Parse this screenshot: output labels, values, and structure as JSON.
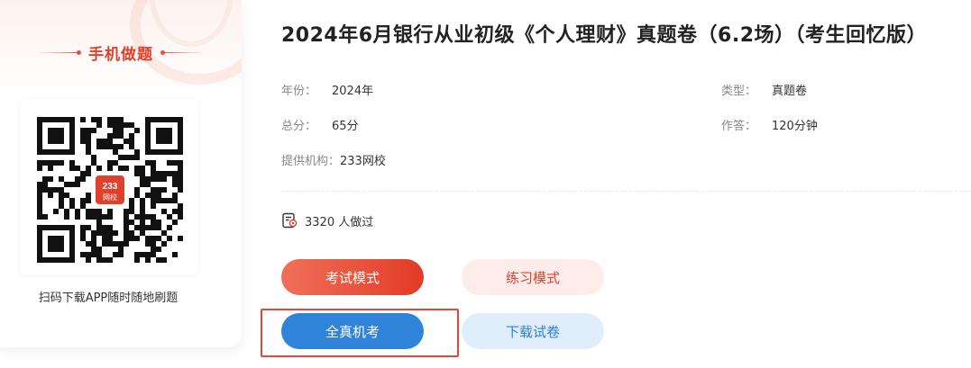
{
  "qr_panel": {
    "title": "手机做题",
    "logo_text_top": "233",
    "logo_text_bottom": "网校",
    "caption": "扫码下载APP随时随地刷题"
  },
  "paper": {
    "title": "2024年6月银行从业初级《个人理财》真题卷（6.2场）（考生回忆版）"
  },
  "meta": {
    "year_label": "年份：",
    "year_value": "2024年",
    "type_label": "类型：",
    "type_value": "真题卷",
    "score_label": "总分：",
    "score_value": "65分",
    "time_label": "作答：",
    "time_value": "120分钟",
    "provider_label": "提供机构：",
    "provider_value": "233网校"
  },
  "stats": {
    "count_text": "3320 人做过"
  },
  "buttons": {
    "exam_mode": "考试模式",
    "practice_mode": "练习模式",
    "full_exam": "全真机考",
    "download": "下载试卷"
  },
  "colors": {
    "accent_red": "#e0412c",
    "accent_blue": "#2f83d8",
    "highlight_border": "#e4463a"
  },
  "icons": {
    "people_icon": "user-count-icon"
  }
}
